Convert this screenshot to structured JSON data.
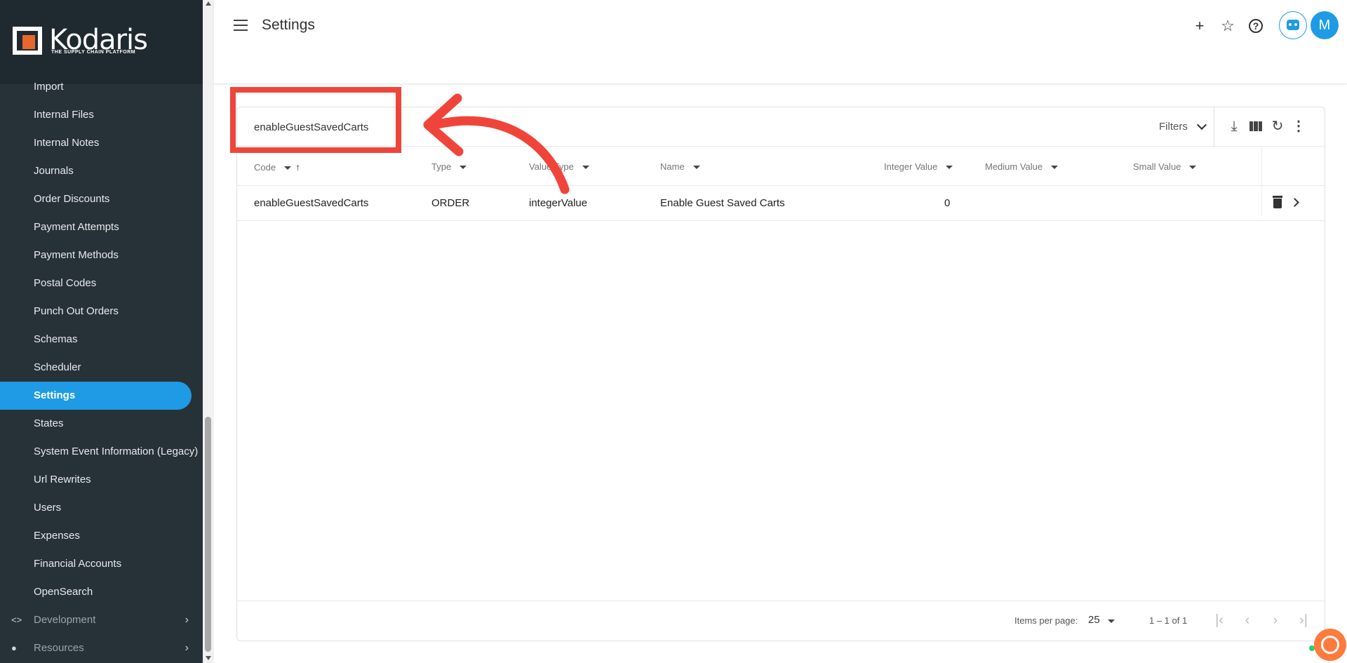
{
  "brand": {
    "name": "Kodaris",
    "tagline": "THE SUPPLY CHAIN PLATFORM",
    "accent": "#1e9be4",
    "sidebar_bg": "#263238"
  },
  "sidebar": {
    "items": [
      {
        "label": "Import"
      },
      {
        "label": "Internal Files"
      },
      {
        "label": "Internal Notes"
      },
      {
        "label": "Journals"
      },
      {
        "label": "Order Discounts"
      },
      {
        "label": "Payment Attempts"
      },
      {
        "label": "Payment Methods"
      },
      {
        "label": "Postal Codes"
      },
      {
        "label": "Punch Out Orders"
      },
      {
        "label": "Schemas"
      },
      {
        "label": "Scheduler"
      },
      {
        "label": "Settings",
        "active": true
      },
      {
        "label": "States"
      },
      {
        "label": "System Event Information (Legacy)"
      },
      {
        "label": "Url Rewrites"
      },
      {
        "label": "Users"
      },
      {
        "label": "Expenses"
      },
      {
        "label": "Financial Accounts"
      },
      {
        "label": "OpenSearch"
      }
    ],
    "groups": [
      {
        "label": "Development",
        "icon": "code-icon"
      },
      {
        "label": "Resources",
        "icon": "help-circle-icon"
      }
    ]
  },
  "header": {
    "title": "Settings",
    "avatar_initial": "M",
    "icons": [
      "menu-icon",
      "add-icon",
      "star-icon",
      "help-icon",
      "bot-icon"
    ]
  },
  "table": {
    "search_value": "enableGuestSavedCarts",
    "filters_label": "Filters",
    "columns": [
      {
        "label": "Code",
        "sorted": "asc"
      },
      {
        "label": "Type"
      },
      {
        "label": "Value Type"
      },
      {
        "label": "Name"
      },
      {
        "label": "Integer Value"
      },
      {
        "label": "Medium Value"
      },
      {
        "label": "Small Value"
      }
    ],
    "rows": [
      {
        "code": "enableGuestSavedCarts",
        "type": "ORDER",
        "value_type": "integerValue",
        "name": "Enable Guest Saved Carts",
        "integer_value": "0",
        "medium_value": "",
        "small_value": ""
      }
    ],
    "pagination": {
      "items_per_page_label": "Items per page:",
      "items_per_page": "25",
      "range": "1 – 1 of 1"
    }
  },
  "annotation": {
    "color": "#f0443a"
  }
}
